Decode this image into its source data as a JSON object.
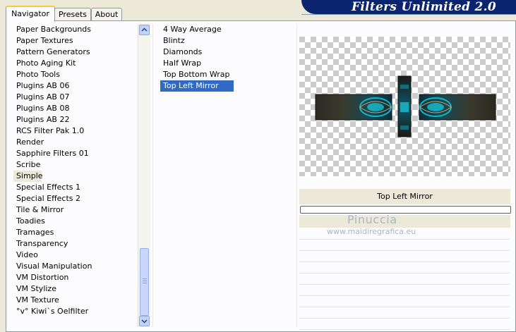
{
  "title": "Filters Unlimited 2.0",
  "tabs": [
    {
      "label": "Navigator",
      "active": true
    },
    {
      "label": "Presets",
      "active": false
    },
    {
      "label": "About",
      "active": false
    }
  ],
  "categories": [
    "Paper Backgrounds",
    "Paper Textures",
    "Pattern Generators",
    "Photo Aging Kit",
    "Photo Tools",
    "Plugins AB 06",
    "Plugins AB 07",
    "Plugins AB 08",
    "Plugins AB 22",
    "RCS Filter Pak 1.0",
    "Render",
    "Sapphire Filters 01",
    "Scribe",
    "Simple",
    "Special Effects 1",
    "Special Effects 2",
    "Tile & Mirror",
    "Toadies",
    "Tramages",
    "Transparency",
    "Video",
    "Visual Manipulation",
    "VM Distortion",
    "VM Stylize",
    "VM Texture",
    "°v° Kiwi`s Oelfilter"
  ],
  "selected_category": "Simple",
  "filters": [
    "4 Way Average",
    "Blintz",
    "Diamonds",
    "Half Wrap",
    "Top Bottom Wrap",
    "Top Left Mirror"
  ],
  "selected_filter": "Top Left Mirror",
  "preview_label": "Top Left Mirror",
  "progress": 0,
  "watermark": {
    "name": "Pinuccia",
    "url": "www.maidiregrafica.eu"
  },
  "colors": {
    "accent": "#0a2470",
    "selection": "#316ac5",
    "teal": "#16b7c8"
  }
}
